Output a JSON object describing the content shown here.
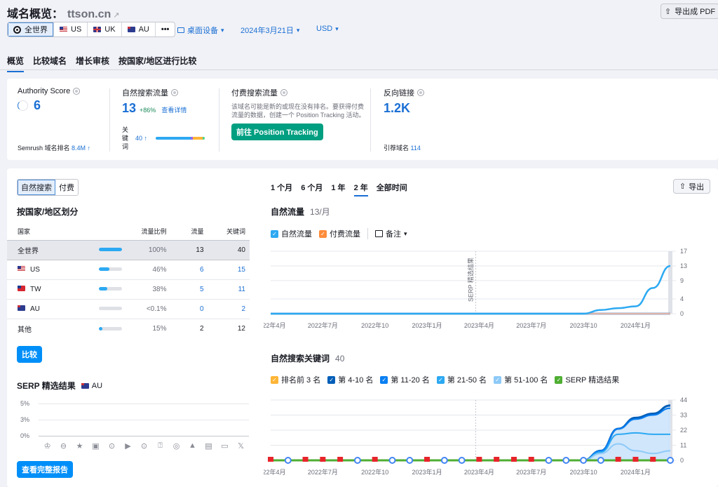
{
  "header": {
    "title": "域名概览：",
    "domain": "ttson.cn",
    "export_pdf": "导出成 PDF"
  },
  "databases": [
    {
      "label": "全世界",
      "icon": "globe-icon",
      "active": true
    },
    {
      "label": "US",
      "icon": "flag-us"
    },
    {
      "label": "UK",
      "icon": "flag-uk"
    },
    {
      "label": "AU",
      "icon": "flag-au"
    },
    {
      "label": "•••",
      "icon": "more-icon"
    }
  ],
  "filters": {
    "device": "桌面设备",
    "date": "2024年3月21日",
    "currency": "USD"
  },
  "tabs": [
    "概览",
    "比较域名",
    "增长审核",
    "按国家/地区进行比较"
  ],
  "summary": {
    "authority": {
      "label": "Authority Score",
      "value": "6",
      "rank_label": "Semrush 域名排名",
      "rank_value": "8.4M ↑"
    },
    "organic": {
      "label": "自然搜索流量",
      "value": "13",
      "change": "+86%",
      "link": "查看详情",
      "kw_label": "关键词",
      "kw_value": "40 ↑"
    },
    "paid": {
      "label": "付费搜索流量",
      "desc": "该域名可能是新的或现在没有排名。要获得付费流量的数据，创建一个 Position Tracking 活动。",
      "button": "前往 Position Tracking"
    },
    "backlinks": {
      "label": "反向链接",
      "value": "1.2K",
      "ref_label": "引荐域名",
      "ref_value": "114"
    }
  },
  "left": {
    "toggle": [
      "自然搜索",
      "付费"
    ],
    "geo_title": "按国家/地区划分",
    "columns": [
      "国家",
      "流量比例",
      "流量",
      "关键词"
    ],
    "rows": [
      {
        "country": "全世界",
        "flag": "",
        "share": "100%",
        "pct": 100,
        "traffic": "13",
        "keywords": "40",
        "selected": true
      },
      {
        "country": "US",
        "flag": "flag-us",
        "share": "46%",
        "pct": 46,
        "traffic": "6",
        "keywords": "15",
        "link": true
      },
      {
        "country": "TW",
        "flag": "flag-tw",
        "share": "38%",
        "pct": 38,
        "traffic": "5",
        "keywords": "11",
        "link": true
      },
      {
        "country": "AU",
        "flag": "flag-au",
        "share": "<0.1%",
        "pct": 0,
        "traffic": "0",
        "keywords": "2",
        "link": true
      },
      {
        "country": "其他",
        "flag": "",
        "share": "15%",
        "pct": 15,
        "traffic": "2",
        "keywords": "12"
      }
    ],
    "compare_button": "比较",
    "serp_title": "SERP 精选结果",
    "serp_db": "AU",
    "serp_y": [
      "5%",
      "3%",
      "0%"
    ],
    "serp_icons": [
      "crown-icon",
      "link-icon",
      "star-icon",
      "image-icon",
      "video-icon",
      "video-box-icon",
      "play-icon",
      "faq-icon",
      "location-icon",
      "education-icon",
      "news-icon",
      "briefcase-icon",
      "x-twitter-icon"
    ],
    "full_report_button": "查看完整报告"
  },
  "right": {
    "periods": [
      "1 个月",
      "6 个月",
      "1 年",
      "2 年",
      "全部时间"
    ],
    "active_period": 3,
    "export": "导出",
    "traffic_title": "自然流量",
    "traffic_sub": "13/月",
    "traffic_legend": [
      {
        "label": "自然流量",
        "color": "#2ca9f2"
      },
      {
        "label": "付费流量",
        "color": "#ff8c3b"
      }
    ],
    "notes": "备注",
    "kw_title": "自然搜索关键词",
    "kw_sub": "40",
    "kw_legend": [
      {
        "label": "排名前 3 名",
        "color": "#ffb536"
      },
      {
        "label": "第 4-10 名",
        "color": "#005eb8"
      },
      {
        "label": "第 11-20 名",
        "color": "#0a7ff2"
      },
      {
        "label": "第 21-50 名",
        "color": "#2ca9f2"
      },
      {
        "label": "第 51-100 名",
        "color": "#8ecaf8"
      },
      {
        "label": "SERP 精选结果",
        "color": "#4fae33"
      }
    ],
    "serp_annotation": "SERP 精选结果"
  },
  "chart_data": [
    {
      "type": "line",
      "title": "自然流量",
      "x": [
        "2022年4月",
        "2022年5月",
        "2022年6月",
        "2022年7月",
        "2022年8月",
        "2022年9月",
        "2022年10月",
        "2022年11月",
        "2022年12月",
        "2023年1月",
        "2023年2月",
        "2023年3月",
        "2023年4月",
        "2023年5月",
        "2023年6月",
        "2023年7月",
        "2023年8月",
        "2023年9月",
        "2023年10月",
        "2023年11月",
        "2023年12月",
        "2024年1月",
        "2024年2月",
        "2024年3月"
      ],
      "xticks": [
        "2022年4月",
        "2022年7月",
        "2022年10",
        "2023年1月",
        "2023年4月",
        "2023年7月",
        "2023年10",
        "2024年1月"
      ],
      "yticks": [
        0,
        4,
        9,
        13,
        17
      ],
      "ylim": [
        0,
        17
      ],
      "series": [
        {
          "name": "自然流量",
          "color": "#2ca9f2",
          "values": [
            0,
            0,
            0,
            0,
            0,
            0,
            0,
            0,
            0,
            0,
            0,
            0,
            0,
            0,
            0,
            0,
            0,
            0,
            0,
            1,
            1.5,
            2,
            7,
            13
          ]
        },
        {
          "name": "付费流量",
          "color": "#ff8c3b",
          "values": [
            0,
            0,
            0,
            0,
            0,
            0,
            0,
            0,
            0,
            0,
            0,
            0,
            0,
            0,
            0,
            0,
            0,
            0,
            0,
            0,
            0,
            0,
            0,
            0
          ]
        }
      ],
      "annotation": {
        "x": "2023年3月",
        "label": "SERP 精选结果"
      }
    },
    {
      "type": "area",
      "title": "自然搜索关键词",
      "x": [
        "2022年4月",
        "2022年5月",
        "2022年6月",
        "2022年7月",
        "2022年8月",
        "2022年9月",
        "2022年10月",
        "2022年11月",
        "2022年12月",
        "2023年1月",
        "2023年2月",
        "2023年3月",
        "2023年4月",
        "2023年5月",
        "2023年6月",
        "2023年7月",
        "2023年8月",
        "2023年9月",
        "2023年10月",
        "2023年11月",
        "2023年12月",
        "2024年1月",
        "2024年2月",
        "2024年3月"
      ],
      "xticks": [
        "2022年4月",
        "2022年7月",
        "2022年10",
        "2023年1月",
        "2023年4月",
        "2023年7月",
        "2023年10",
        "2024年1月"
      ],
      "yticks": [
        0,
        11,
        22,
        33,
        44
      ],
      "ylim": [
        0,
        44
      ],
      "series": [
        {
          "name": "第 51-100 名",
          "color": "#8ecaf8",
          "values": [
            0,
            0,
            0,
            0,
            0,
            0,
            0,
            0,
            0,
            0,
            0,
            0,
            0,
            0,
            0,
            0,
            0,
            0,
            0,
            5,
            12,
            7,
            5,
            7
          ]
        },
        {
          "name": "第 21-50 名",
          "color": "#2ca9f2",
          "values": [
            0,
            0,
            0,
            0,
            0,
            0,
            0,
            0,
            0,
            0,
            0,
            0,
            0,
            0,
            0,
            0,
            0,
            0,
            0,
            6,
            19,
            20,
            19,
            19
          ]
        },
        {
          "name": "第 11-20 名",
          "color": "#0a7ff2",
          "values": [
            0,
            0,
            0,
            0,
            0,
            0,
            0,
            0,
            0,
            0,
            0,
            0,
            0,
            0,
            0,
            0,
            0,
            0,
            0,
            7,
            23,
            30,
            33,
            38
          ]
        },
        {
          "name": "第 4-10 名",
          "color": "#005eb8",
          "values": [
            0,
            0,
            0,
            0,
            0,
            0,
            0,
            0,
            0,
            0,
            0,
            0,
            0,
            0,
            0,
            0,
            0,
            0,
            0,
            7,
            23,
            31,
            34,
            40
          ]
        },
        {
          "name": "排名前 3 名",
          "color": "#ffb536",
          "values": [
            0,
            0,
            0,
            0,
            0,
            0,
            0,
            0,
            0,
            0,
            0,
            0,
            0,
            0,
            0,
            0,
            0,
            0,
            0,
            0,
            0,
            0,
            0,
            0
          ]
        },
        {
          "name": "SERP 精选结果",
          "color": "#4fae33",
          "values": [
            0,
            0,
            0,
            0,
            0,
            0,
            0,
            0,
            0,
            0,
            0,
            0,
            0,
            0,
            0,
            0,
            0,
            0,
            0,
            0,
            0,
            0,
            0,
            0
          ]
        }
      ],
      "markers": [
        "flag",
        "google",
        "flag",
        "flag",
        "flag",
        "google",
        "flag",
        "google",
        "google",
        "flag",
        "google",
        "google",
        "flag",
        "flag",
        "flag",
        "flag",
        "google",
        "google",
        "google",
        "google",
        "flag",
        "flag",
        "flag",
        "google"
      ]
    }
  ]
}
